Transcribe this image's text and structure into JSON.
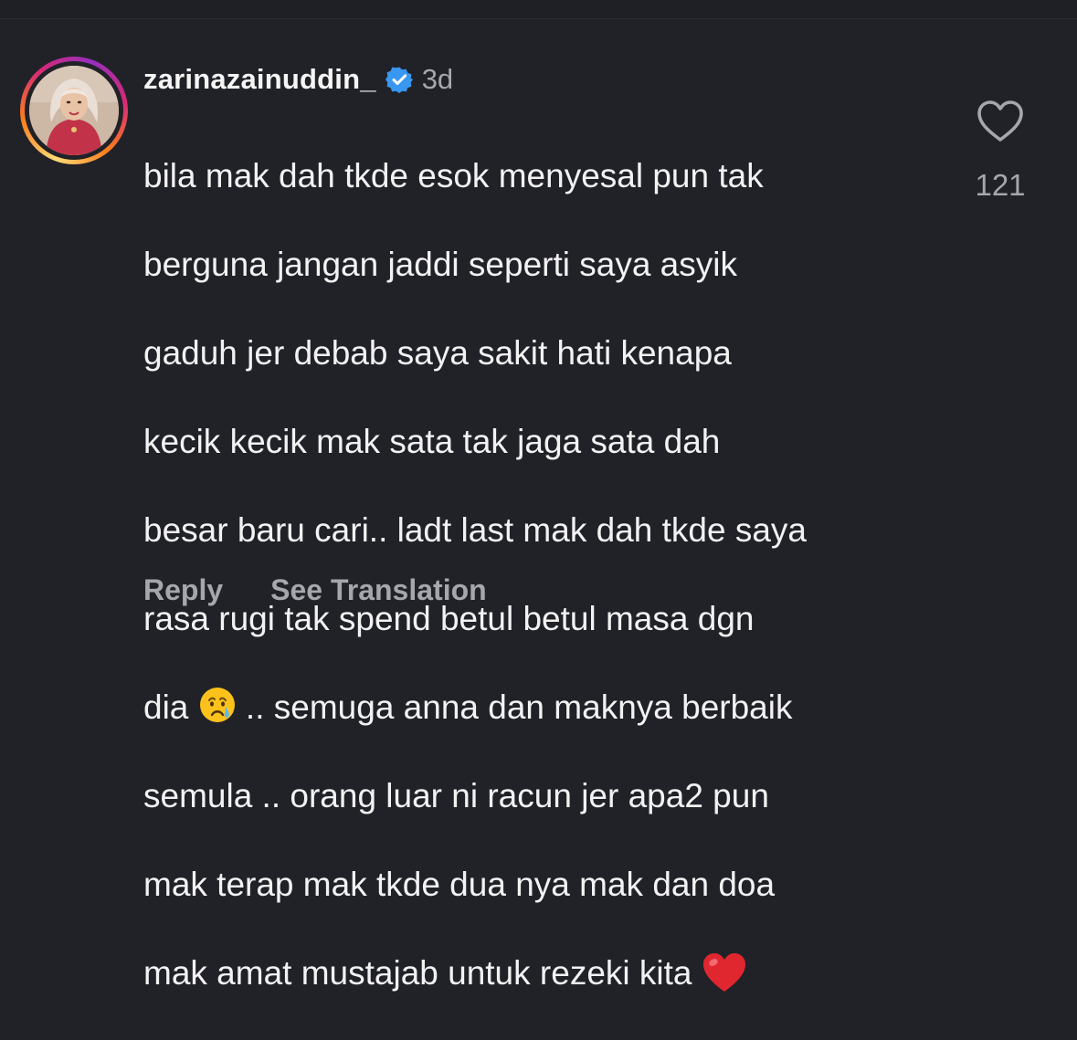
{
  "comment": {
    "username": "zarinazainuddin_",
    "verified": true,
    "timestamp": "3d",
    "lines": {
      "l1": "bila mak dah tkde esok menyesal pun tak",
      "l2": "berguna jangan jaddi seperti saya asyik",
      "l3": "gaduh jer debab saya sakit hati kenapa",
      "l4": "kecik kecik mak sata tak jaga sata dah",
      "l5": "besar baru cari.. ladt last mak dah tkde saya",
      "l6": "rasa rugi tak spend betul betul masa dgn",
      "l7a": "dia ",
      "l7b": " .. semuga anna dan maknya berbaik",
      "l8": "semula .. orang luar ni racun jer apa2 pun",
      "l9": "mak terap mak tkde dua nya mak dan doa",
      "l10": "mak amat mustajab untuk rezeki kita "
    },
    "emoji": {
      "crying": "crying-face-icon",
      "heart": "red-heart-icon"
    },
    "likes": "121"
  },
  "actions": {
    "reply_label": "Reply",
    "translate_label": "See Translation"
  },
  "icons": {
    "like": "heart-outline-icon",
    "verified": "verified-badge-icon"
  },
  "colors": {
    "background": "#212227",
    "verified_blue": "#3897f0",
    "muted_text": "#a6a7ad",
    "heart_red": "#e0262f"
  }
}
